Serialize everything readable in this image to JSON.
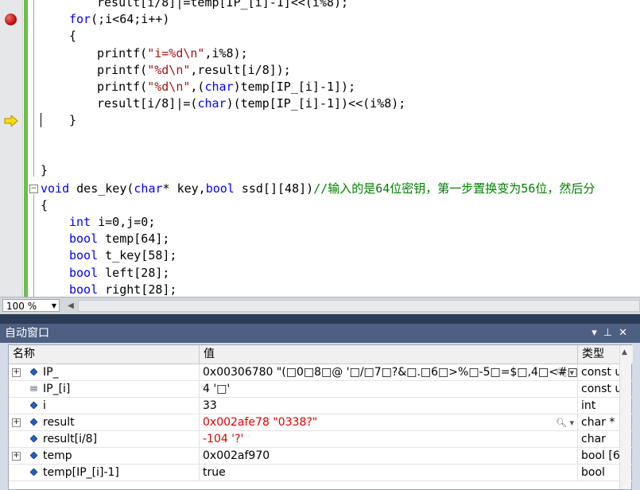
{
  "editor": {
    "code_lines": [
      "result[i/8]|=temp[IP_[i]-1]<<(i%8);",
      "for(;i<64;i++)",
      "{",
      "printf(\"i=%d\\n\",i%8);",
      "printf(\"%d\\n\",result[i/8]);",
      "printf(\"%d\\n\",(char)temp[IP_[i]-1]);",
      "result[i/8]|=(char)(temp[IP_[i]-1])<<(i%8);",
      "}",
      "}",
      "void des_key(char* key,bool ssd[][48])//输入的是64位密钥，第一步置换变为56位，然后分",
      "{",
      "int i=0,j=0;",
      "bool temp[64];",
      "bool t_key[58];",
      "bool left[28];",
      "bool right[28];"
    ],
    "zoom": "100 %"
  },
  "panel": {
    "title": "自动窗口",
    "columns": [
      "名称",
      "值",
      "类型"
    ],
    "rows": [
      {
        "name": "IP_",
        "value": "0x00306780 \"(□0□8□@ '□/□7□?&□.□6□>%□-5□=$□,4□<#□+□3□",
        "type": "const u",
        "expandable": true,
        "red": false,
        "magnifier": true
      },
      {
        "name": "IP_[i]",
        "value": "4 '□'",
        "type": "const u",
        "expandable": false,
        "red": false,
        "magnifier": false
      },
      {
        "name": "i",
        "value": "33",
        "type": "int",
        "expandable": false,
        "red": false,
        "magnifier": false
      },
      {
        "name": "result",
        "value": "0x002afe78 \"0338?\"",
        "type": "char *",
        "expandable": true,
        "red": true,
        "magnifier": true
      },
      {
        "name": "result[i/8]",
        "value": "-104 '?'",
        "type": "char",
        "expandable": false,
        "red": true,
        "magnifier": false
      },
      {
        "name": "temp",
        "value": "0x002af970",
        "type": "bool [6",
        "expandable": true,
        "red": false,
        "magnifier": false
      },
      {
        "name": "temp[IP_[i]-1]",
        "value": "true",
        "type": "bool",
        "expandable": false,
        "red": false,
        "magnifier": false
      }
    ]
  }
}
